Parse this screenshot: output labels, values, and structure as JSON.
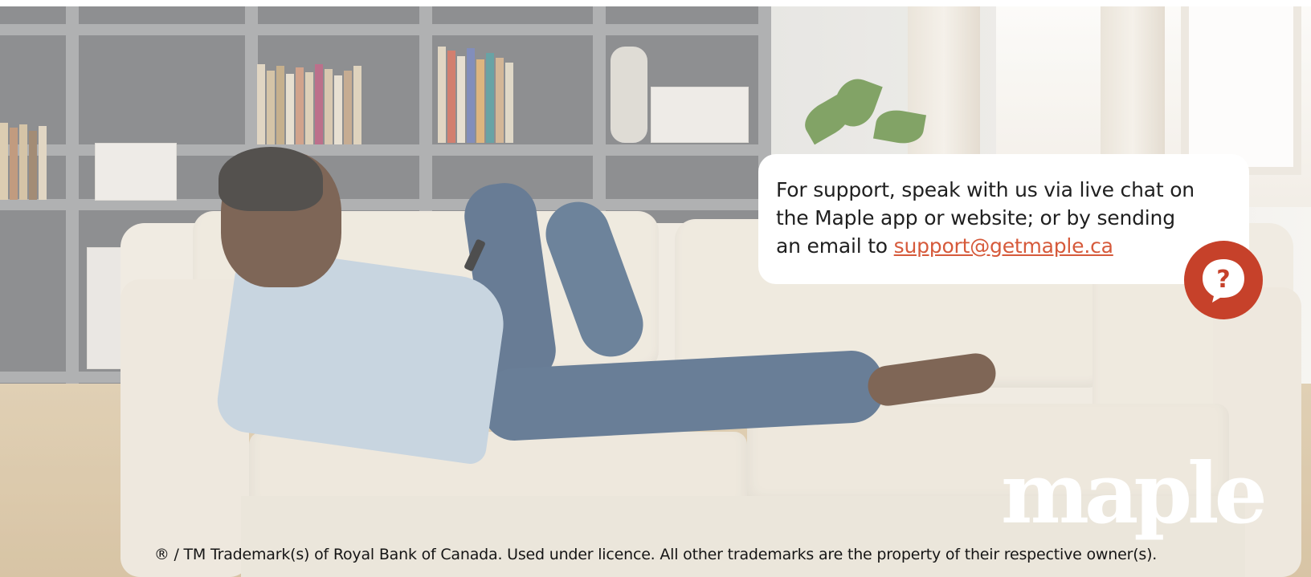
{
  "support": {
    "line1": "For support, speak with us via live chat on",
    "line2": "the Maple app or website; or by sending",
    "line3_prefix": "an email to ",
    "email": "support@getmaple.ca"
  },
  "brand": {
    "logo_text": "maple",
    "accent_color": "#c6412a",
    "link_color": "#d65a3b"
  },
  "footer": {
    "legal": "® / TM Trademark(s) of Royal Bank of Canada. Used under licence. All other trademarks are the property of their respective owner(s)."
  },
  "icons": {
    "help": "question-speech-bubble-icon"
  }
}
